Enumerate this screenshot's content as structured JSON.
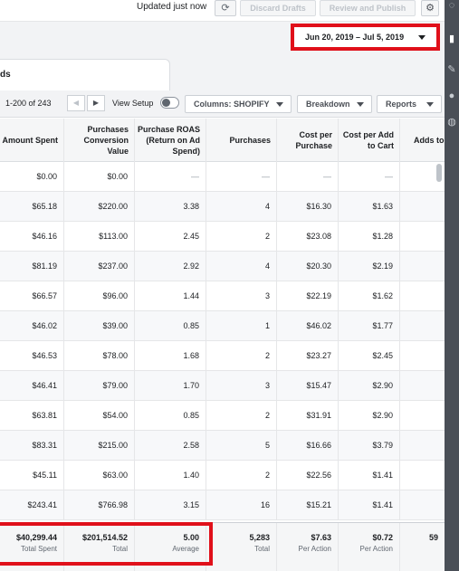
{
  "topbar": {
    "status": "Updated just now",
    "discard_label": "Discard Drafts",
    "review_label": "Review and Publish"
  },
  "date_range": "Jun 20, 2019 – Jul 5, 2019",
  "tab": {
    "label": "ds"
  },
  "toolbar": {
    "range": "1-200 of 243",
    "view_setup": "View Setup",
    "columns": "Columns: SHOPIFY",
    "breakdown": "Breakdown",
    "reports": "Reports"
  },
  "columns": [
    "Amount Spent",
    "Purchases Conversion Value",
    "Purchase ROAS (Return on Ad Spend)",
    "Purchases",
    "Cost per Purchase",
    "Cost per Add to Cart",
    "Adds to"
  ],
  "rows": [
    [
      "$0.00",
      "$0.00",
      "—",
      "—",
      "—",
      "—"
    ],
    [
      "$65.18",
      "$220.00",
      "3.38",
      "4",
      "$16.30",
      "$1.63"
    ],
    [
      "$46.16",
      "$113.00",
      "2.45",
      "2",
      "$23.08",
      "$1.28"
    ],
    [
      "$81.19",
      "$237.00",
      "2.92",
      "4",
      "$20.30",
      "$2.19"
    ],
    [
      "$66.57",
      "$96.00",
      "1.44",
      "3",
      "$22.19",
      "$1.62"
    ],
    [
      "$46.02",
      "$39.00",
      "0.85",
      "1",
      "$46.02",
      "$1.77"
    ],
    [
      "$46.53",
      "$78.00",
      "1.68",
      "2",
      "$23.27",
      "$2.45"
    ],
    [
      "$46.41",
      "$79.00",
      "1.70",
      "3",
      "$15.47",
      "$2.90"
    ],
    [
      "$63.81",
      "$54.00",
      "0.85",
      "2",
      "$31.91",
      "$2.90"
    ],
    [
      "$83.31",
      "$215.00",
      "2.58",
      "5",
      "$16.66",
      "$3.79"
    ],
    [
      "$45.11",
      "$63.00",
      "1.40",
      "2",
      "$22.56",
      "$1.41"
    ],
    [
      "$243.41",
      "$766.98",
      "3.15",
      "16",
      "$15.21",
      "$1.41"
    ]
  ],
  "totals": [
    {
      "value": "$40,299.44",
      "label": "Total Spent"
    },
    {
      "value": "$201,514.52",
      "label": "Total"
    },
    {
      "value": "5.00",
      "label": "Average"
    },
    {
      "value": "5,283",
      "label": "Total"
    },
    {
      "value": "$7.63",
      "label": "Per Action"
    },
    {
      "value": "$0.72",
      "label": "Per Action"
    },
    {
      "value": "59",
      "label": ""
    }
  ],
  "colors": {
    "highlight": "#e0101a",
    "side_panel": "#4a4f57"
  }
}
